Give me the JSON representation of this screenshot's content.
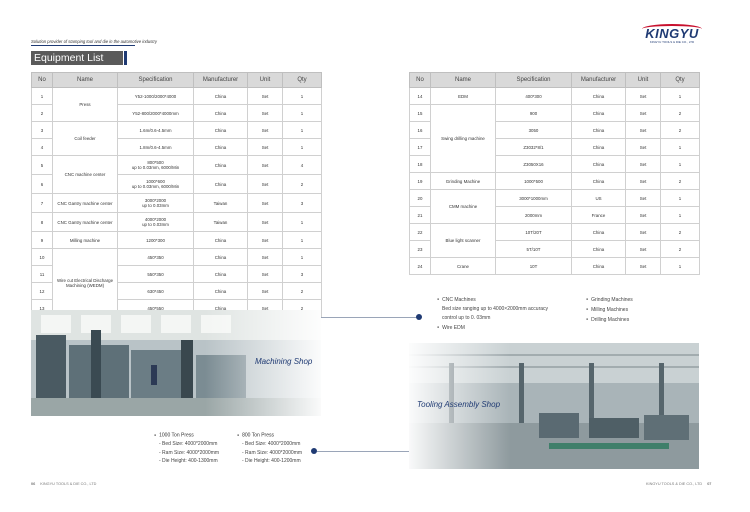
{
  "header": {
    "tagline": "Solution provider of stamping tool and die in the automotive industry",
    "section_title": "Equipment List",
    "logo_text": "KINGYU",
    "logo_sub": "KINGYU TOOLS & DIE CO., LTD"
  },
  "table_left": {
    "columns": [
      "No",
      "Name",
      "Specification",
      "Manufacturer",
      "Unit",
      "Qty"
    ],
    "rows": [
      {
        "no": "1",
        "name": "Press",
        "spec": "Y52-1000/2000*4000",
        "mfr": "China",
        "unit": "Set",
        "qty": "1"
      },
      {
        "no": "2",
        "name": "",
        "spec": "Y52-800/2000*4000mm",
        "mfr": "China",
        "unit": "Set",
        "qty": "1"
      },
      {
        "no": "3",
        "name": "Coil feeder",
        "spec": "1.6m/0.6-4.5mm",
        "mfr": "China",
        "unit": "Set",
        "qty": "1"
      },
      {
        "no": "4",
        "name": "",
        "spec": "1.8m/0.6-4.5mm",
        "mfr": "China",
        "unit": "Set",
        "qty": "1"
      },
      {
        "no": "5",
        "name": "CNC machine center",
        "spec": "800*500\nup to 0.03mm, 6000/Min",
        "mfr": "China",
        "unit": "Set",
        "qty": "4"
      },
      {
        "no": "6",
        "name": "",
        "spec": "1000*600\nup to 0.03mm, 6000/Min",
        "mfr": "China",
        "unit": "Set",
        "qty": "2"
      },
      {
        "no": "7",
        "name": "CNC Gantry machine center",
        "spec": "3000*2000\nup to 0.03mm",
        "mfr": "Taiwan",
        "unit": "Set",
        "qty": "3"
      },
      {
        "no": "8",
        "name": "CNC Gantry machine center",
        "spec": "4000*2000\nup to 0.03mm",
        "mfr": "Taiwan",
        "unit": "Set",
        "qty": "1"
      },
      {
        "no": "9",
        "name": "Milling machine",
        "spec": "1200*300",
        "mfr": "China",
        "unit": "Set",
        "qty": "1"
      },
      {
        "no": "10",
        "name": "Wire cut Electrical Discharge Machining (WEDM)",
        "spec": "450*350",
        "mfr": "China",
        "unit": "Set",
        "qty": "1"
      },
      {
        "no": "11",
        "name": "",
        "spec": "550*350",
        "mfr": "China",
        "unit": "Set",
        "qty": "3"
      },
      {
        "no": "12",
        "name": "",
        "spec": "630*450",
        "mfr": "China",
        "unit": "Set",
        "qty": "2"
      },
      {
        "no": "13",
        "name": "",
        "spec": "450*550",
        "mfr": "China",
        "unit": "Set",
        "qty": "2"
      }
    ]
  },
  "table_right": {
    "columns": [
      "No",
      "Name",
      "Specification",
      "Manufacturer",
      "Unit",
      "Qty"
    ],
    "rows": [
      {
        "no": "14",
        "name": "EDM",
        "spec": "400*300",
        "mfr": "China",
        "unit": "Set",
        "qty": "1"
      },
      {
        "no": "15",
        "name": "Swing drilling machine",
        "spec": "900",
        "mfr": "China",
        "unit": "Set",
        "qty": "2"
      },
      {
        "no": "16",
        "name": "",
        "spec": "3050",
        "mfr": "China",
        "unit": "Set",
        "qty": "2"
      },
      {
        "no": "17",
        "name": "",
        "spec": "Z3032*8/1",
        "mfr": "China",
        "unit": "Set",
        "qty": "1"
      },
      {
        "no": "18",
        "name": "",
        "spec": "Z3050X16",
        "mfr": "China",
        "unit": "Set",
        "qty": "1"
      },
      {
        "no": "19",
        "name": "Grinding Machine",
        "spec": "1000*500",
        "mfr": "China",
        "unit": "Set",
        "qty": "2"
      },
      {
        "no": "20",
        "name": "CMM machine",
        "spec": "3000*1000mm",
        "mfr": "US",
        "unit": "Set",
        "qty": "1"
      },
      {
        "no": "21",
        "name": "",
        "spec": "2000mm",
        "mfr": "France",
        "unit": "Set",
        "qty": "1"
      },
      {
        "no": "22",
        "name": "Blue light scanner",
        "spec": "10T/20T",
        "mfr": "China",
        "unit": "Set",
        "qty": "2"
      },
      {
        "no": "23",
        "name": "",
        "spec": "5T/10T",
        "mfr": "China",
        "unit": "Set",
        "qty": "2"
      },
      {
        "no": "24",
        "name": "Crane",
        "spec": "10T",
        "mfr": "China",
        "unit": "Set",
        "qty": "1"
      }
    ]
  },
  "machining_shop": {
    "label": "Machining Shop",
    "col1": [
      "CNC Machines",
      "Bed size ranging up to 4000×2000mm accuracy",
      "control up to 0. 03mm",
      "Wire EDM"
    ],
    "col2": [
      "Grinding Machines",
      "Milling Machines",
      "Drilling Machines"
    ]
  },
  "tooling_shop": {
    "label": "Tooling Assembly Shop",
    "press1": {
      "title": "1000 Ton Press",
      "lines": [
        "- Bed Size: 4000*2000mm",
        "- Ram Size: 4000*2000mm",
        "- Die Height: 400-1300mm"
      ]
    },
    "press2": {
      "title": "800 Ton Press",
      "lines": [
        "- Bed Size: 4000*2000mm",
        "- Ram Size: 4000*2000mm",
        "- Die Height: 400-1200mm"
      ]
    }
  },
  "footer": {
    "left_page": "06",
    "left_company": "KINGYU TOOLS & DIE CO., LTD",
    "right_company": "KINGYU TOOLS & DIE CO., LTD",
    "right_page": "07"
  },
  "colors": {
    "brand": "#1f3a73",
    "title_bg": "#5a5a5a",
    "header_bg": "#d9d9d9"
  }
}
